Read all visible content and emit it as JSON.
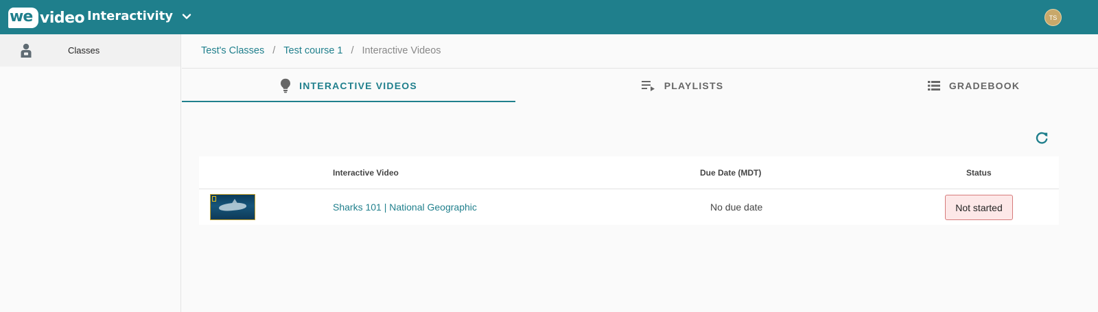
{
  "header": {
    "logo_we": "we",
    "logo_video": "video",
    "app_title": "Interactivity",
    "avatar_initials": "TS",
    "bar_color": "#1f7f8c"
  },
  "sidebar": {
    "items": [
      {
        "label": "Classes",
        "icon": "student-icon",
        "active": true
      }
    ]
  },
  "breadcrumb": {
    "items": [
      "Test's Classes",
      "Test course 1"
    ],
    "separator": "/",
    "current": "Interactive Videos"
  },
  "tabs": [
    {
      "label": "INTERACTIVE VIDEOS",
      "icon": "lightbulb-icon",
      "active": true
    },
    {
      "label": "PLAYLISTS",
      "icon": "playlist-icon",
      "active": false
    },
    {
      "label": "GRADEBOOK",
      "icon": "list-icon",
      "active": false
    }
  ],
  "toolbar": {
    "refresh_icon": "refresh-icon"
  },
  "table": {
    "columns": [
      "Interactive Video",
      "Due Date (MDT)",
      "Status"
    ],
    "rows": [
      {
        "title": "Sharks 101 | National Geographic",
        "due": "No due date",
        "status": "Not started"
      }
    ]
  },
  "colors": {
    "accent": "#1f7f8c",
    "status_bg": "#fde8e8",
    "status_border": "#d67a7a"
  }
}
